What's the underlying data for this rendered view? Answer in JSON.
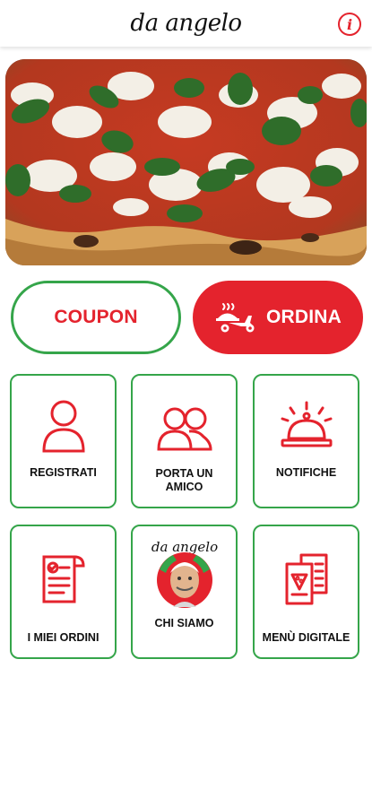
{
  "header": {
    "brand": "da angelo",
    "info_label": "i"
  },
  "hero": {
    "image_desc": "pizza-margherita"
  },
  "actions": {
    "coupon_label": "COUPON",
    "ordina_label": "ORDINA"
  },
  "tiles": [
    {
      "label": "REGISTRATI",
      "icon": "user-icon"
    },
    {
      "label": "PORTA UN AMICO",
      "icon": "friends-icon"
    },
    {
      "label": "NOTIFICHE",
      "icon": "bell-icon"
    },
    {
      "label": "I MIEI ORDINI",
      "icon": "orders-icon"
    },
    {
      "label": "CHI SIAMO",
      "icon": "logo-portrait",
      "logo_text": "da angelo"
    },
    {
      "label": "MENÙ DIGITALE",
      "icon": "menu-icon"
    }
  ],
  "colors": {
    "accent_red": "#e4232d",
    "accent_green": "#35a54a"
  }
}
